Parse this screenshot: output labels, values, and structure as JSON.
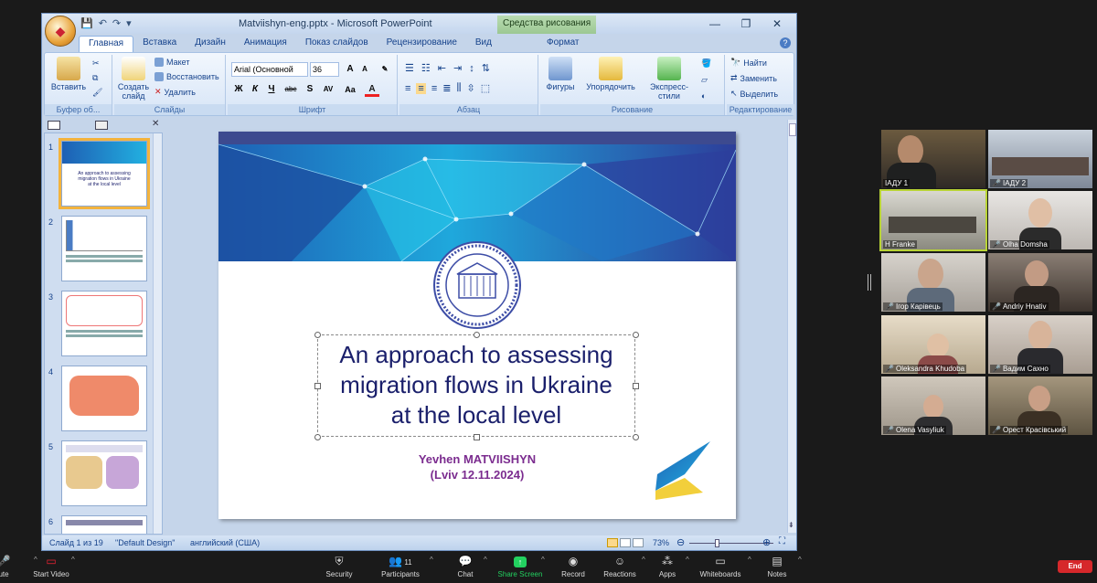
{
  "ppt": {
    "window_title": "Matviishyn-eng.pptx - Microsoft PowerPoint",
    "context_tab": "Средства рисования",
    "tabs": [
      "Главная",
      "Вставка",
      "Дизайн",
      "Анимация",
      "Показ слайдов",
      "Рецензирование",
      "Вид",
      "Формат"
    ],
    "ribbon": {
      "clipboard": {
        "label": "Буфер об...",
        "paste": "Вставить"
      },
      "slides": {
        "label": "Слайды",
        "new_slide": "Создать слайд",
        "layout": "Макет",
        "reset": "Восстановить",
        "delete": "Удалить"
      },
      "font": {
        "label": "Шрифт",
        "font_name": "Arial (Основной",
        "font_size": "36",
        "buttons": [
          "Ж",
          "К",
          "Ч",
          "abc",
          "S",
          "AV",
          "Aa",
          "A"
        ]
      },
      "paragraph": {
        "label": "Абзац"
      },
      "drawing": {
        "label": "Рисование",
        "shapes": "Фигуры",
        "arrange": "Упорядочить",
        "quick_styles": "Экспресс-стили"
      },
      "editing": {
        "label": "Редактирование",
        "find": "Найти",
        "replace": "Заменить",
        "select": "Выделить"
      }
    },
    "thumbnails": [
      "1",
      "2",
      "3",
      "4",
      "5",
      "6"
    ],
    "slide": {
      "title_lines": [
        "An approach to assessing",
        "migration flows in Ukraine",
        "at the local level"
      ],
      "author": "Yevhen MATVIISHYN",
      "date_line": "(Lviv  12.11.2024)"
    },
    "status": {
      "slide_of": "Слайд 1 из 19",
      "design": "\"Default Design\"",
      "language": "английский (США)",
      "zoom": "73%"
    },
    "colors": {
      "accent_blue": "#1e5fb4",
      "title_navy": "#1a1f6b",
      "author_purple": "#7b2c8f"
    }
  },
  "participants": [
    {
      "name": "ІАДУ 1",
      "muted": false
    },
    {
      "name": "ІАДУ 2",
      "muted": true
    },
    {
      "name": "H Franke",
      "muted": false
    },
    {
      "name": "Olha Domsha",
      "muted": true
    },
    {
      "name": "Ігор Карівець",
      "muted": true
    },
    {
      "name": "Andriy Hnativ",
      "muted": true
    },
    {
      "name": "Oleksandra Khudoba",
      "muted": true
    },
    {
      "name": "Вадим Сахно",
      "muted": true
    },
    {
      "name": "Olena Vasyliuk",
      "muted": true
    },
    {
      "name": "Орест Красівський",
      "muted": true
    }
  ],
  "toolbar": {
    "mute_label": "ute",
    "video": "Start Video",
    "security": "Security",
    "participants": "Participants",
    "participants_count": "11",
    "chat": "Chat",
    "share": "Share Screen",
    "record": "Record",
    "reactions": "Reactions",
    "apps": "Apps",
    "whiteboards": "Whiteboards",
    "notes": "Notes",
    "end": "End"
  }
}
